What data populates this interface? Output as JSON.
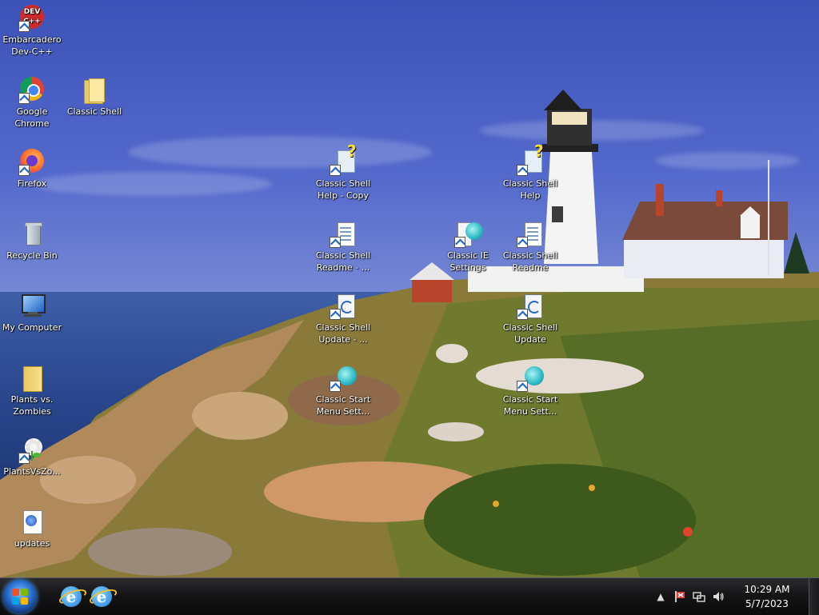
{
  "desktop": {
    "icons": [
      {
        "id": "devcpp",
        "label": "Embarcadero\nDev-C++",
        "icon": "devcpp-icon"
      },
      {
        "id": "chrome",
        "label": "Google\nChrome",
        "icon": "chrome-icon"
      },
      {
        "id": "classicshell-folder",
        "label": "Classic Shell",
        "icon": "folder-icon"
      },
      {
        "id": "firefox",
        "label": "Firefox",
        "icon": "firefox-icon"
      },
      {
        "id": "recycle",
        "label": "Recycle Bin",
        "icon": "recycle-bin-icon"
      },
      {
        "id": "mycomputer",
        "label": "My Computer",
        "icon": "computer-icon"
      },
      {
        "id": "pvz-folder",
        "label": "Plants vs.\nZombies",
        "icon": "folder-icon"
      },
      {
        "id": "pvz",
        "label": "PlantsVsZo...",
        "icon": "plants-vs-zombies-icon"
      },
      {
        "id": "updates",
        "label": "updates",
        "icon": "updates-icon"
      },
      {
        "id": "cs-help-copy",
        "label": "Classic Shell\nHelp - Copy",
        "icon": "help-icon"
      },
      {
        "id": "cs-readme-copy",
        "label": "Classic Shell\nReadme - ...",
        "icon": "document-icon"
      },
      {
        "id": "cs-update-copy",
        "label": "Classic Shell\nUpdate - ...",
        "icon": "update-icon"
      },
      {
        "id": "cs-startmenu-copy",
        "label": "Classic Start\nMenu Sett...",
        "icon": "shell-icon"
      },
      {
        "id": "cs-ie",
        "label": "Classic IE\nSettings",
        "icon": "shell-icon"
      },
      {
        "id": "cs-help",
        "label": "Classic Shell\nHelp",
        "icon": "help-icon"
      },
      {
        "id": "cs-readme",
        "label": "Classic Shell\nReadme",
        "icon": "document-icon"
      },
      {
        "id": "cs-update",
        "label": "Classic Shell\nUpdate",
        "icon": "update-icon"
      },
      {
        "id": "cs-startmenu",
        "label": "Classic Start\nMenu Sett...",
        "icon": "shell-icon"
      }
    ]
  },
  "taskbar": {
    "start_icon": "windows-start-icon",
    "pinned": [
      {
        "label": "Internet Explorer",
        "icon": "internet-explorer-icon"
      },
      {
        "label": "Internet Explorer",
        "icon": "internet-explorer-icon"
      }
    ],
    "tray": {
      "icons": [
        "show-hidden-icons-icon",
        "action-center-flag-icon",
        "network-icon",
        "volume-icon"
      ],
      "time": "10:29 AM",
      "date": "5/7/2023"
    }
  },
  "colors": {
    "taskbar": "#151517",
    "sky": "#4a5fc4",
    "sea": "#2a478e",
    "start_orb": "#2a6fd0"
  }
}
